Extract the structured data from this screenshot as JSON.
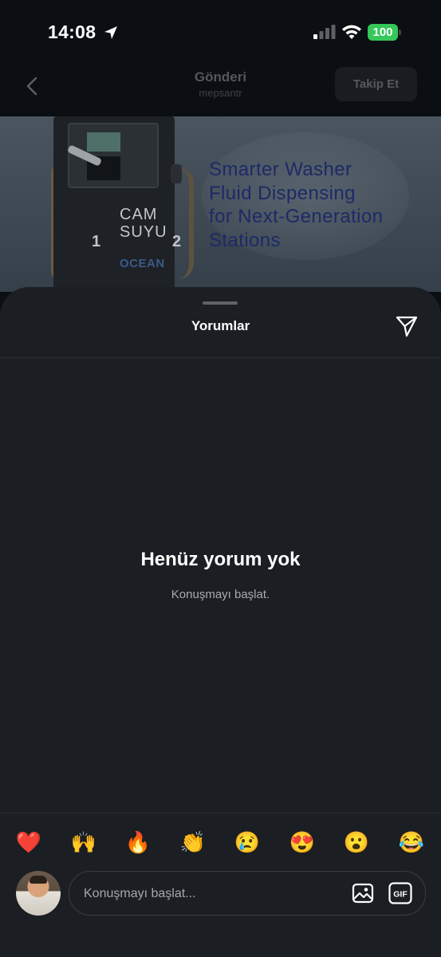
{
  "status_bar": {
    "time": "14:08",
    "battery": "100"
  },
  "header": {
    "title": "Gönderi",
    "subtitle": "mepsantr",
    "follow_label": "Takip Et"
  },
  "post_image": {
    "pump_label_line1": "CAM",
    "pump_label_line2": "SUYU",
    "pump_number_left": "1",
    "pump_number_right": "2",
    "pump_brand": "OCEAN",
    "headline": [
      "Smarter Washer",
      "Fluid Dispensing",
      "for Next-Generation",
      "Stations"
    ]
  },
  "comments": {
    "title": "Yorumlar",
    "empty_title": "Henüz yorum yok",
    "empty_subtitle": "Konuşmayı başlat.",
    "input_placeholder": "Konuşmayı başlat...",
    "gif_label": "GIF"
  },
  "emojis": [
    "❤️",
    "🙌",
    "🔥",
    "👏",
    "😢",
    "😍",
    "😮",
    "😂"
  ],
  "colors": {
    "sheet_bg": "#1b1e22",
    "page_bg": "#0b0e12",
    "battery_green": "#34c759",
    "headline_navy": "#1d2a66"
  }
}
